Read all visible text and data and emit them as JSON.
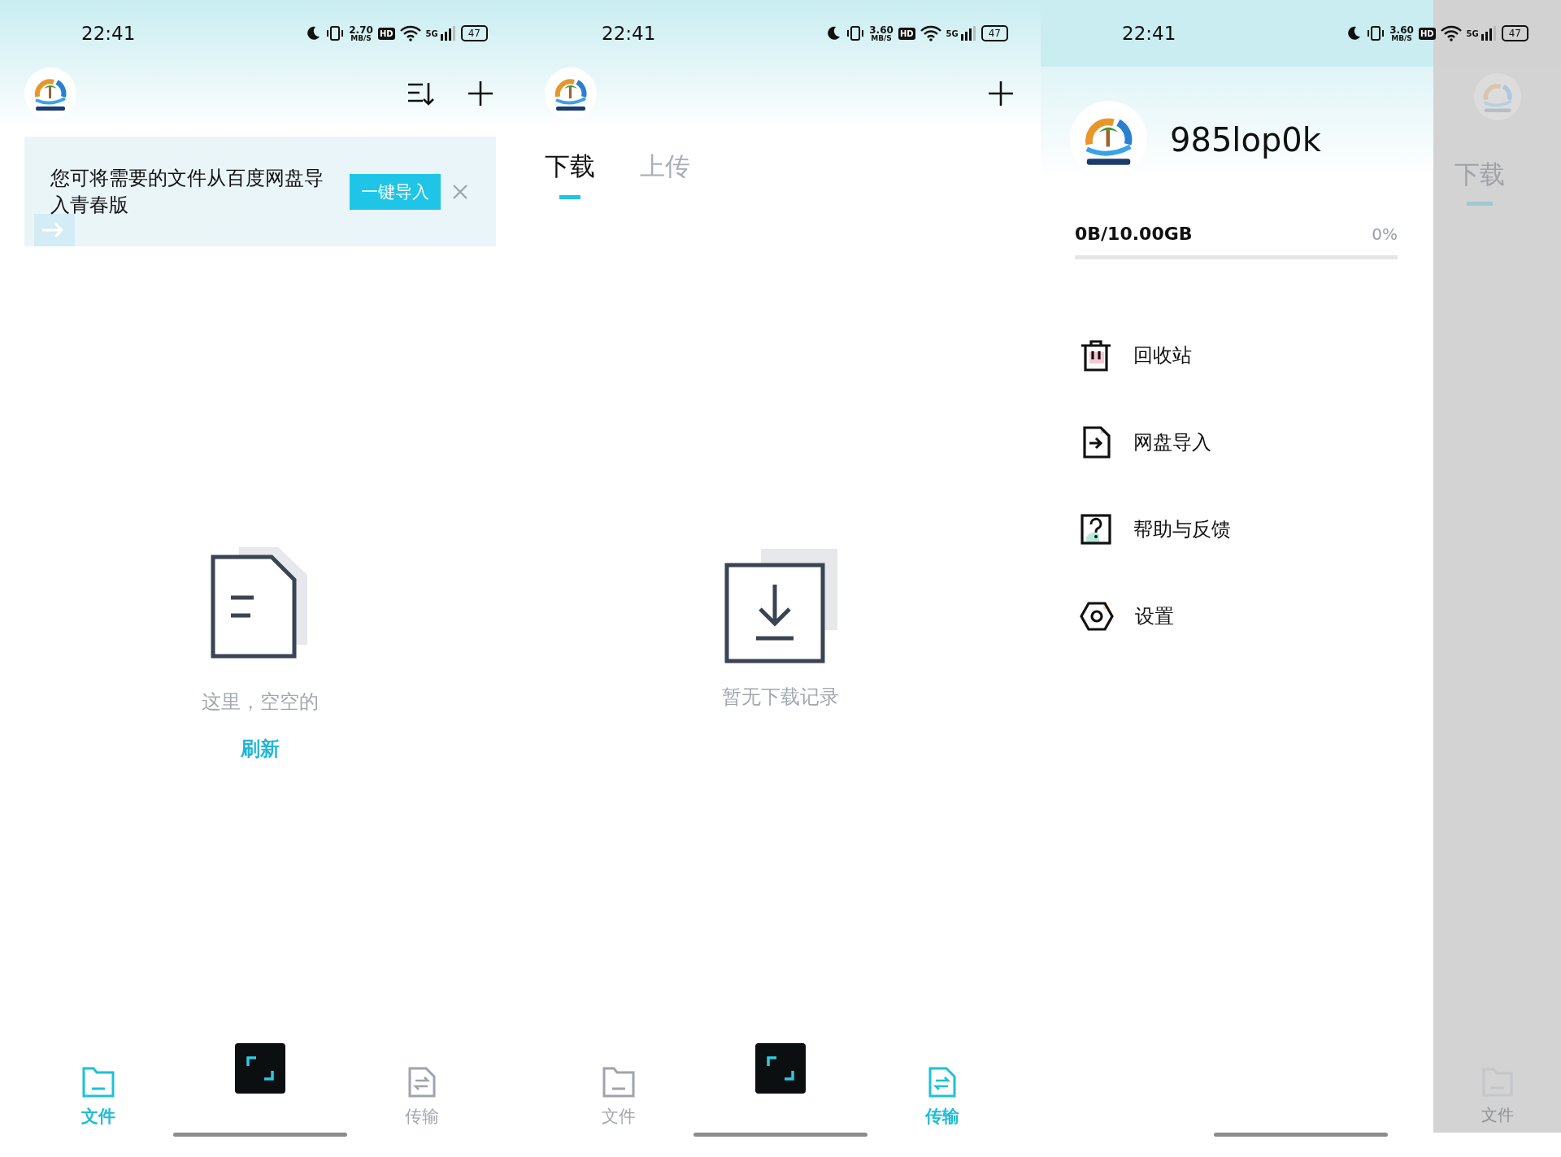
{
  "panels": [
    {
      "kind": "files",
      "status_bar": {
        "time": "22:41",
        "speed": "2.70",
        "speed_unit": "MB/S",
        "hd": "HD",
        "network": "5G",
        "battery": "47"
      },
      "banner": {
        "text": "您可将需要的文件从百度网盘导入青春版",
        "button": "一键导入"
      },
      "empty": {
        "message": "这里，空空的",
        "action": "刷新"
      },
      "nav": [
        {
          "label": "文件",
          "selected": true
        },
        {
          "label": "传输",
          "selected": false
        }
      ]
    },
    {
      "kind": "transfers",
      "status_bar": {
        "time": "22:41",
        "speed": "3.60",
        "speed_unit": "MB/S",
        "hd": "HD",
        "network": "5G",
        "battery": "47"
      },
      "tabs": [
        {
          "label": "下载",
          "selected": true
        },
        {
          "label": "上传",
          "selected": false
        }
      ],
      "empty": {
        "message": "暂无下载记录"
      },
      "nav": [
        {
          "label": "文件",
          "selected": false
        },
        {
          "label": "传输",
          "selected": true
        }
      ]
    },
    {
      "kind": "drawer",
      "status_bar": {
        "time": "22:41",
        "speed": "3.60",
        "speed_unit": "MB/S",
        "hd": "HD",
        "network": "5G",
        "battery": "47"
      },
      "user": {
        "name": "985lop0k"
      },
      "storage": {
        "used": "0B/10.00GB",
        "percent": "0%",
        "level": 0
      },
      "menu": [
        {
          "kind": "trash",
          "label": "回收站"
        },
        {
          "kind": "import",
          "label": "网盘导入"
        },
        {
          "kind": "help",
          "label": "帮助与反馈"
        },
        {
          "kind": "settings",
          "label": "设置"
        }
      ],
      "behind": {
        "tab": "下载",
        "nav_label": "文件"
      }
    }
  ]
}
